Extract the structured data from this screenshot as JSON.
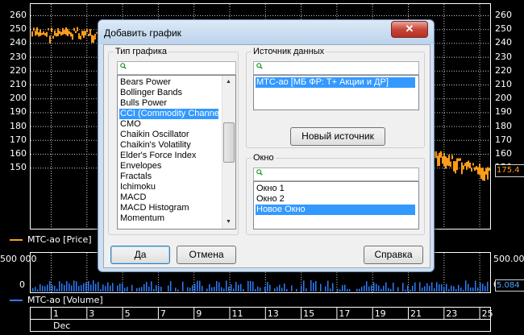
{
  "chart": {
    "y_ticks": [
      "260",
      "250",
      "240",
      "230",
      "220",
      "210",
      "200",
      "190",
      "180",
      "170",
      "160",
      "150"
    ],
    "price_legend": "MTC-ao [Price]",
    "last_price": "175.4",
    "volume_ticks_left": [
      "500 000",
      "0"
    ],
    "volume_ticks_right": [
      "500.00",
      "0"
    ],
    "last_volume": "5.084",
    "volume_legend": "MTC-ao [Volume]",
    "x_ticks": [
      "1",
      "3",
      "5",
      "7",
      "9",
      "11",
      "13",
      "15",
      "17",
      "19",
      "21",
      "23",
      "25"
    ],
    "x_month": "Dec",
    "colors": {
      "price": "#ff9c1a",
      "volume": "#2d7dff",
      "grid": "#ffffff"
    }
  },
  "dialog": {
    "title": "Добавить график",
    "close_label": "✕",
    "chart_type": {
      "label": "Тип графика",
      "items": [
        "Bears Power",
        "Bollinger Bands",
        "Bulls Power",
        "CCI (Commodity Channel",
        "CMO",
        "Chaikin Oscillator",
        "Chaikin's Volatility",
        "Elder's Force Index",
        "Envelopes",
        "Fractals",
        "Ichimoku",
        "MACD",
        "MACD Histogram",
        "Momentum"
      ],
      "selected": "CCI (Commodity Channel"
    },
    "data_source": {
      "label": "Источник данных",
      "items": [
        "MTC-ao [МБ ФР: Т+ Акции и ДР]"
      ],
      "selected": "MTC-ao [МБ ФР: Т+ Акции и ДР]",
      "new_source_button": "Новый источник"
    },
    "window": {
      "label": "Окно",
      "items": [
        "Окно 1",
        "Окно 2",
        "Новое Окно"
      ],
      "selected": "Новое Окно"
    },
    "buttons": {
      "ok": "Да",
      "cancel": "Отмена",
      "help": "Справка"
    }
  }
}
